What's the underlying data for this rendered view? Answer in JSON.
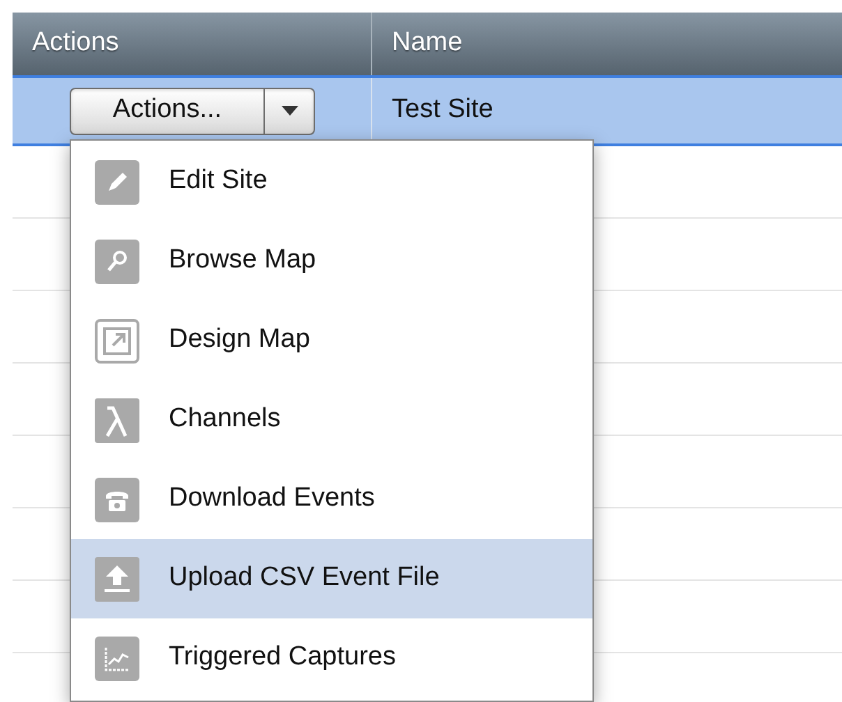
{
  "table": {
    "columns": [
      "Actions",
      "Name"
    ],
    "rows": [
      {
        "selected": true,
        "button": {
          "label": "Actions...",
          "expanded": true
        },
        "name": "Test Site"
      }
    ]
  },
  "menu": {
    "items": [
      {
        "label": "Edit Site",
        "selected": false
      },
      {
        "label": "Browse Map",
        "selected": false
      },
      {
        "label": "Design Map",
        "selected": false
      },
      {
        "label": "Channels",
        "selected": false
      },
      {
        "label": "Download Events",
        "selected": false
      },
      {
        "label": "Upload CSV Event File",
        "selected": true
      },
      {
        "label": "Triggered Captures",
        "selected": false
      }
    ]
  }
}
